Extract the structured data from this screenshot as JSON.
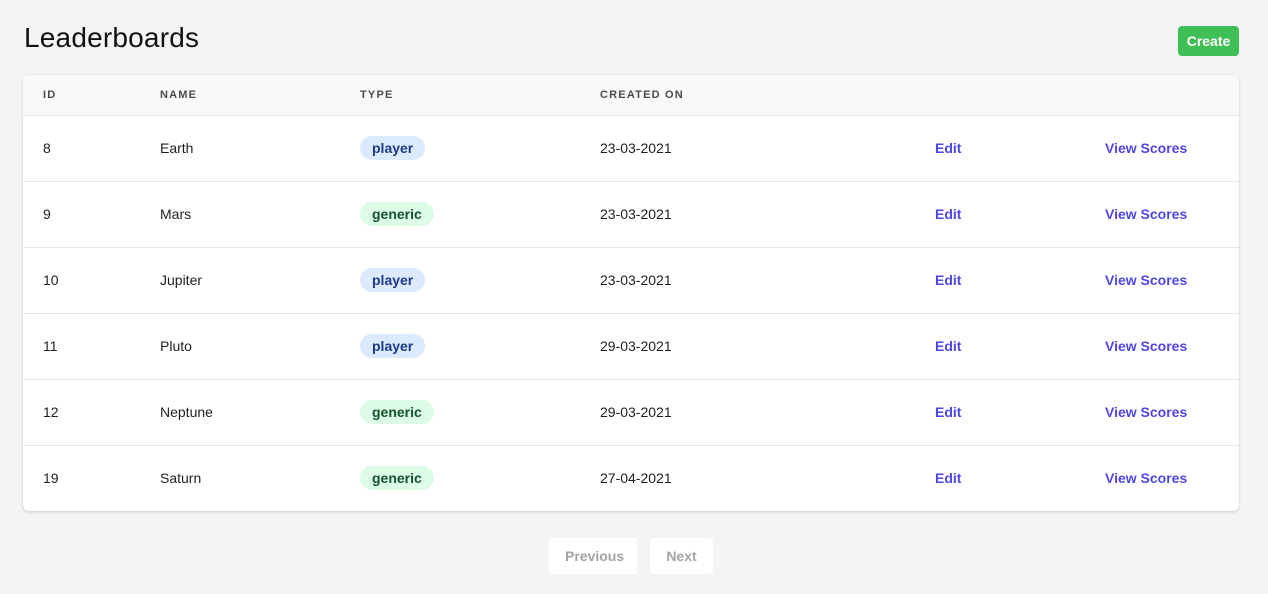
{
  "header": {
    "title": "Leaderboards",
    "create_label": "Create"
  },
  "table": {
    "columns": {
      "id": "ID",
      "name": "NAME",
      "type": "TYPE",
      "created_on": "CREATED ON"
    },
    "rows": [
      {
        "id": "8",
        "name": "Earth",
        "type": "player",
        "created_on": "23-03-2021",
        "edit": "Edit",
        "view": "View Scores"
      },
      {
        "id": "9",
        "name": "Mars",
        "type": "generic",
        "created_on": "23-03-2021",
        "edit": "Edit",
        "view": "View Scores"
      },
      {
        "id": "10",
        "name": "Jupiter",
        "type": "player",
        "created_on": "23-03-2021",
        "edit": "Edit",
        "view": "View Scores"
      },
      {
        "id": "11",
        "name": "Pluto",
        "type": "player",
        "created_on": "29-03-2021",
        "edit": "Edit",
        "view": "View Scores"
      },
      {
        "id": "12",
        "name": "Neptune",
        "type": "generic",
        "created_on": "29-03-2021",
        "edit": "Edit",
        "view": "View Scores"
      },
      {
        "id": "19",
        "name": "Saturn",
        "type": "generic",
        "created_on": "27-04-2021",
        "edit": "Edit",
        "view": "View Scores"
      }
    ]
  },
  "pagination": {
    "previous_label": "Previous",
    "next_label": "Next"
  },
  "colors": {
    "create_button": "#3fbf56",
    "link": "#4f46e5",
    "badge_player_bg": "#dbeafe",
    "badge_generic_bg": "#dcfce7"
  }
}
